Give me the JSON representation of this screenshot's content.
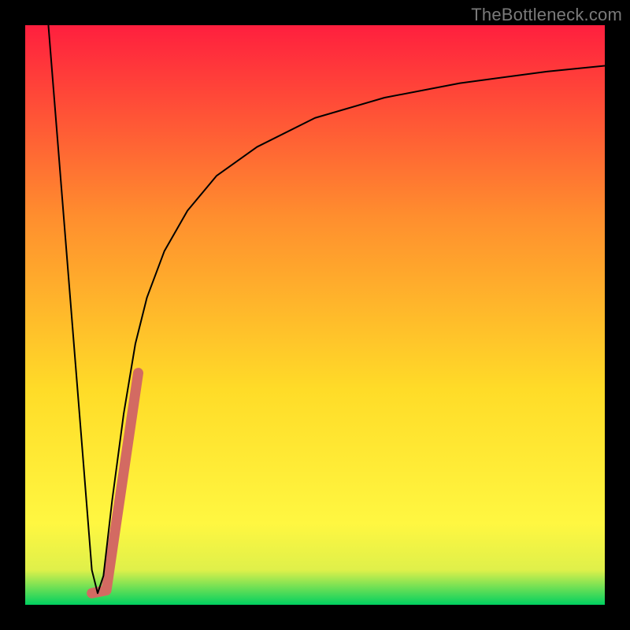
{
  "watermark": "TheBottleneck.com",
  "chart_data": {
    "type": "line",
    "title": "",
    "xlabel": "",
    "ylabel": "",
    "xlim": [
      0,
      100
    ],
    "ylim": [
      0,
      100
    ],
    "grid": false,
    "legend": false,
    "background_gradient": {
      "top": "#ff1f3e",
      "mid": "#ffdc28",
      "bottom": "#00d060"
    },
    "series": [
      {
        "name": "black-curve",
        "color": "#000000",
        "stroke_width": 2,
        "x": [
          4,
          6,
          8,
          10,
          11.5,
          12.5,
          13.5,
          15,
          17,
          19,
          21,
          24,
          28,
          33,
          40,
          50,
          62,
          75,
          90,
          100
        ],
        "y": [
          100,
          75,
          50,
          25,
          6,
          2,
          5,
          18,
          33,
          45,
          53,
          61,
          68,
          74,
          79,
          84,
          87.5,
          90,
          92,
          93
        ]
      },
      {
        "name": "coral-segment",
        "color": "#d36a62",
        "stroke_width": 13,
        "linecap": "round",
        "x": [
          11.5,
          14.0,
          19.5
        ],
        "y": [
          2.0,
          2.5,
          40.0
        ]
      }
    ]
  }
}
